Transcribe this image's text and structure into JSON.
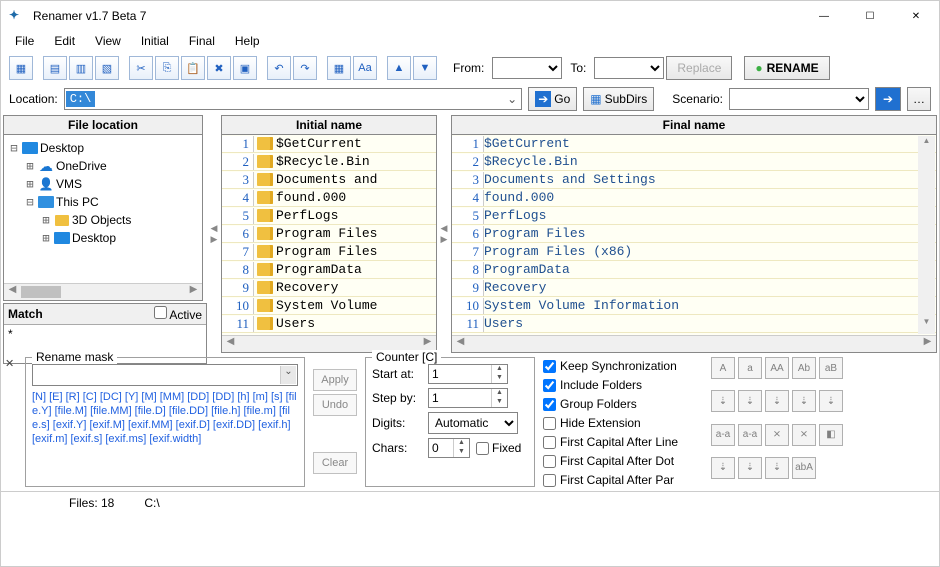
{
  "window": {
    "title": "Renamer v1.7 Beta 7"
  },
  "menus": [
    "File",
    "Edit",
    "View",
    "Initial",
    "Final",
    "Help"
  ],
  "toolbar": {
    "from": "From:",
    "to": "To:",
    "replace": "Replace",
    "rename": "RENAME"
  },
  "locbar": {
    "label": "Location:",
    "path": "C:\\",
    "go": "Go",
    "subdirs": "SubDirs",
    "scenario": "Scenario:"
  },
  "panels": {
    "fileloc": "File location",
    "initial": "Initial name",
    "final": "Final name"
  },
  "tree": [
    {
      "indent": 0,
      "exp": "⊟",
      "icon": "desk",
      "label": "Desktop"
    },
    {
      "indent": 1,
      "exp": "⊞",
      "icon": "cloud",
      "label": "OneDrive"
    },
    {
      "indent": 1,
      "exp": "⊞",
      "icon": "user",
      "label": "VMS"
    },
    {
      "indent": 1,
      "exp": "⊟",
      "icon": "pc",
      "label": "This PC"
    },
    {
      "indent": 2,
      "exp": "⊞",
      "icon": "fol",
      "label": "3D Objects"
    },
    {
      "indent": 2,
      "exp": "⊞",
      "icon": "desk",
      "label": "Desktop"
    }
  ],
  "match": {
    "title": "Match",
    "active": "Active",
    "pattern": "*"
  },
  "initial_list": [
    "$GetCurrent",
    "$Recycle.Bin",
    "Documents and",
    "found.000",
    "PerfLogs",
    "Program Files",
    "Program Files",
    "ProgramData",
    "Recovery",
    "System Volume",
    "Users"
  ],
  "final_list": [
    "$GetCurrent",
    "$Recycle.Bin",
    "Documents and Settings",
    "found.000",
    "PerfLogs",
    "Program Files",
    "Program Files (x86)",
    "ProgramData",
    "Recovery",
    "System Volume Information",
    "Users"
  ],
  "mask": {
    "title": "Rename mask",
    "apply": "Apply",
    "undo": "Undo",
    "clear": "Clear",
    "tokens": "[N]  [E]  [R]  [C]  [DC]  [Y]  [M]  [MM]  [DD]  [DD]  [h]  [m]  [s]  [file.Y]  [file.M]  [file.MM]  [file.D]  [file.DD]  [file.h]  [file.m]  [file.s]  [exif.Y]  [exif.M]  [exif.MM]  [exif.D]  [exif.DD]  [exif.h]  [exif.m]  [exif.s]  [exif.ms]  [exif.width]"
  },
  "counter": {
    "title": "Counter [C]",
    "startat": "Start at:",
    "startat_val": "1",
    "stepby": "Step by:",
    "stepby_val": "1",
    "digits": "Digits:",
    "digits_val": "Automatic",
    "chars": "Chars:",
    "chars_val": "0",
    "fixed": "Fixed"
  },
  "options": [
    {
      "label": "Keep Synchronization",
      "checked": true
    },
    {
      "label": "Include Folders",
      "checked": true
    },
    {
      "label": "Group Folders",
      "checked": true
    },
    {
      "label": "Hide Extension",
      "checked": false
    },
    {
      "label": "First Capital After Line",
      "checked": false
    },
    {
      "label": "First Capital After Dot",
      "checked": false
    },
    {
      "label": "First Capital After Par",
      "checked": false
    }
  ],
  "casebtns": [
    "A",
    "a",
    "AA",
    "Ab",
    "aB",
    "⇣",
    "⇣",
    "⇣",
    "⇣",
    "⇣",
    "a-a",
    "a-a",
    "⨯",
    "⨯",
    "◧",
    "⇣",
    "⇣",
    "⇣",
    "abA"
  ],
  "status": {
    "files": "Files: 18",
    "path": "C:\\"
  }
}
